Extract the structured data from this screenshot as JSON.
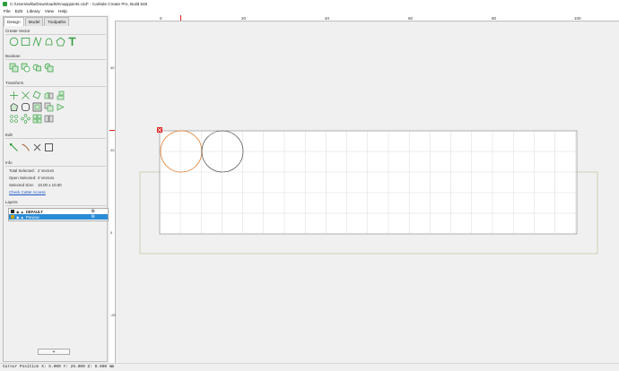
{
  "window": {
    "title": "C:/Users/willa/Downloads/Knappjoints.c2d* - Carbide Create Pro, Build 845"
  },
  "menu": [
    "File",
    "Edit",
    "Library",
    "View",
    "Help"
  ],
  "tabs": [
    "Design",
    "Model",
    "Toolpaths"
  ],
  "sections": {
    "create_vector": "Create Vector",
    "boolean": "Boolean",
    "transform": "Transform",
    "edit": "Edit",
    "info": "Info",
    "layers": "Layers"
  },
  "info": {
    "total_selected_label": "Total Selected:",
    "total_selected_value": "2 Vectors",
    "open_selected_label": "Open Selected:",
    "open_selected_value": "0 Vectors",
    "selected_size_label": "Selected Size:",
    "selected_size_value": "10.00 x 10.00",
    "check_cutter_access": "Check Cutter Access"
  },
  "layers": [
    {
      "name": "DEFAULT",
      "color": "#222222",
      "selected": false
    },
    {
      "name": "Preview",
      "color": "#c8a200",
      "selected": true
    }
  ],
  "add_button": "+",
  "ruler": {
    "top_labels": [
      "0",
      "20",
      "40",
      "60",
      "80",
      "100"
    ],
    "left_labels": [
      "40",
      "20",
      "0",
      "-20"
    ]
  },
  "status": {
    "cursor_position": "Cursor Position X: 5.000 Y: 25.000 Z: 0.000 mm"
  },
  "colors": {
    "selected_circle": "#e07a28",
    "circle": "#333333",
    "stock_outline": "#c8c8a8",
    "accent": "#2a8bd6"
  }
}
